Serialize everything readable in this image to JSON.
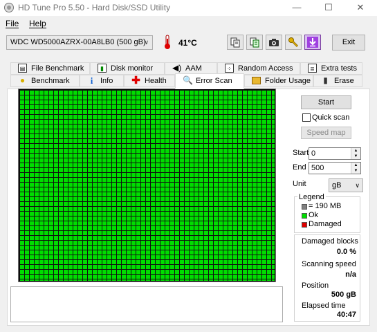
{
  "window": {
    "title": "HD Tune Pro 5.50 - Hard Disk/SSD Utility",
    "minimize": "—",
    "maximize": "☐",
    "close": "✕"
  },
  "menu": {
    "file": "File",
    "help": "Help"
  },
  "toolbar": {
    "drive": "WDC WD5000AZRX-00A8LB0 (500 gB)",
    "temperature": "41°C",
    "exit_label": "Exit",
    "icons": [
      "copy-icon",
      "copy-info-icon",
      "camera-icon",
      "wrench-icon",
      "download-icon"
    ]
  },
  "tabs_top": [
    {
      "label": "File Benchmark",
      "icon": "file-benchmark-icon"
    },
    {
      "label": "Disk monitor",
      "icon": "disk-monitor-icon"
    },
    {
      "label": "AAM",
      "icon": "speaker-icon"
    },
    {
      "label": "Random Access",
      "icon": "random-access-icon"
    },
    {
      "label": "Extra tests",
      "icon": "extra-tests-icon"
    }
  ],
  "tabs_bottom": [
    {
      "label": "Benchmark",
      "icon": "lightbulb-icon"
    },
    {
      "label": "Info",
      "icon": "info-icon"
    },
    {
      "label": "Health",
      "icon": "health-cross-icon"
    },
    {
      "label": "Error Scan",
      "icon": "magnifier-icon",
      "active": true
    },
    {
      "label": "Folder Usage",
      "icon": "folder-icon"
    },
    {
      "label": "Erase",
      "icon": "trash-icon"
    }
  ],
  "scan": {
    "start_button": "Start",
    "quick_scan_label": "Quick scan",
    "quick_scan_checked": false,
    "speed_map_button": "Speed map",
    "start_label": "Start",
    "start_value": "0",
    "end_label": "End",
    "end_value": "500",
    "unit_label": "Unit",
    "unit_value": "gB",
    "block_color": "#00dd00"
  },
  "legend": {
    "title": "Legend",
    "items": [
      {
        "label": "= 190 MB",
        "color": "#808080"
      },
      {
        "label": "Ok",
        "color": "#00dd00"
      },
      {
        "label": "Damaged",
        "color": "#e00000"
      }
    ]
  },
  "stats": {
    "damaged_label": "Damaged blocks",
    "damaged_value": "0.0 %",
    "speed_label": "Scanning speed",
    "speed_value": "n/a",
    "position_label": "Position",
    "position_value": "500 gB",
    "elapsed_label": "Elapsed time",
    "elapsed_value": "40:47"
  }
}
